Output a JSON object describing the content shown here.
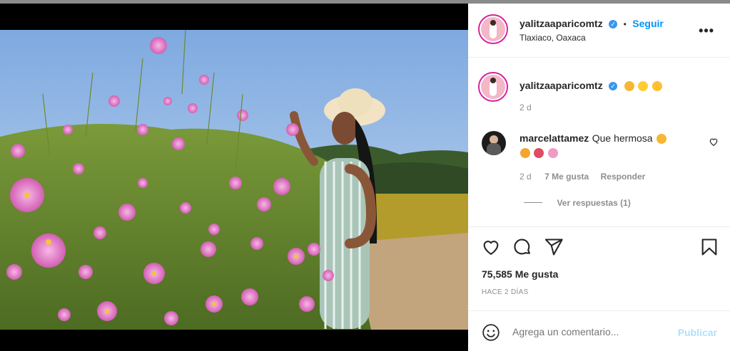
{
  "post": {
    "author": "yalitzaaparicomtz",
    "follow_label": "Seguir",
    "location": "Tlaxiaco, Oaxaca",
    "more_label": "•••"
  },
  "caption": {
    "author": "yalitzaaparicomtz",
    "time": "2 d"
  },
  "comment": {
    "author": "marcelattamez",
    "text": "Que hermosa",
    "time": "2 d",
    "likes": "7 Me gusta",
    "reply_label": "Responder",
    "view_replies": "Ver respuestas (1)"
  },
  "actions": {
    "likes_count": "75,585 Me gusta",
    "posted": "HACE 2 DÍAS"
  },
  "composer": {
    "placeholder": "Agrega un comentario...",
    "publish_label": "Publicar"
  },
  "colors": {
    "link": "#0095f6",
    "verified": "#3897f0",
    "muted": "#8e8e8e",
    "publish_disabled": "#b2dffc"
  },
  "icons": [
    "verified-icon",
    "more-icon",
    "heart-icon",
    "comment-icon",
    "share-icon",
    "bookmark-icon",
    "emoji-icon"
  ]
}
